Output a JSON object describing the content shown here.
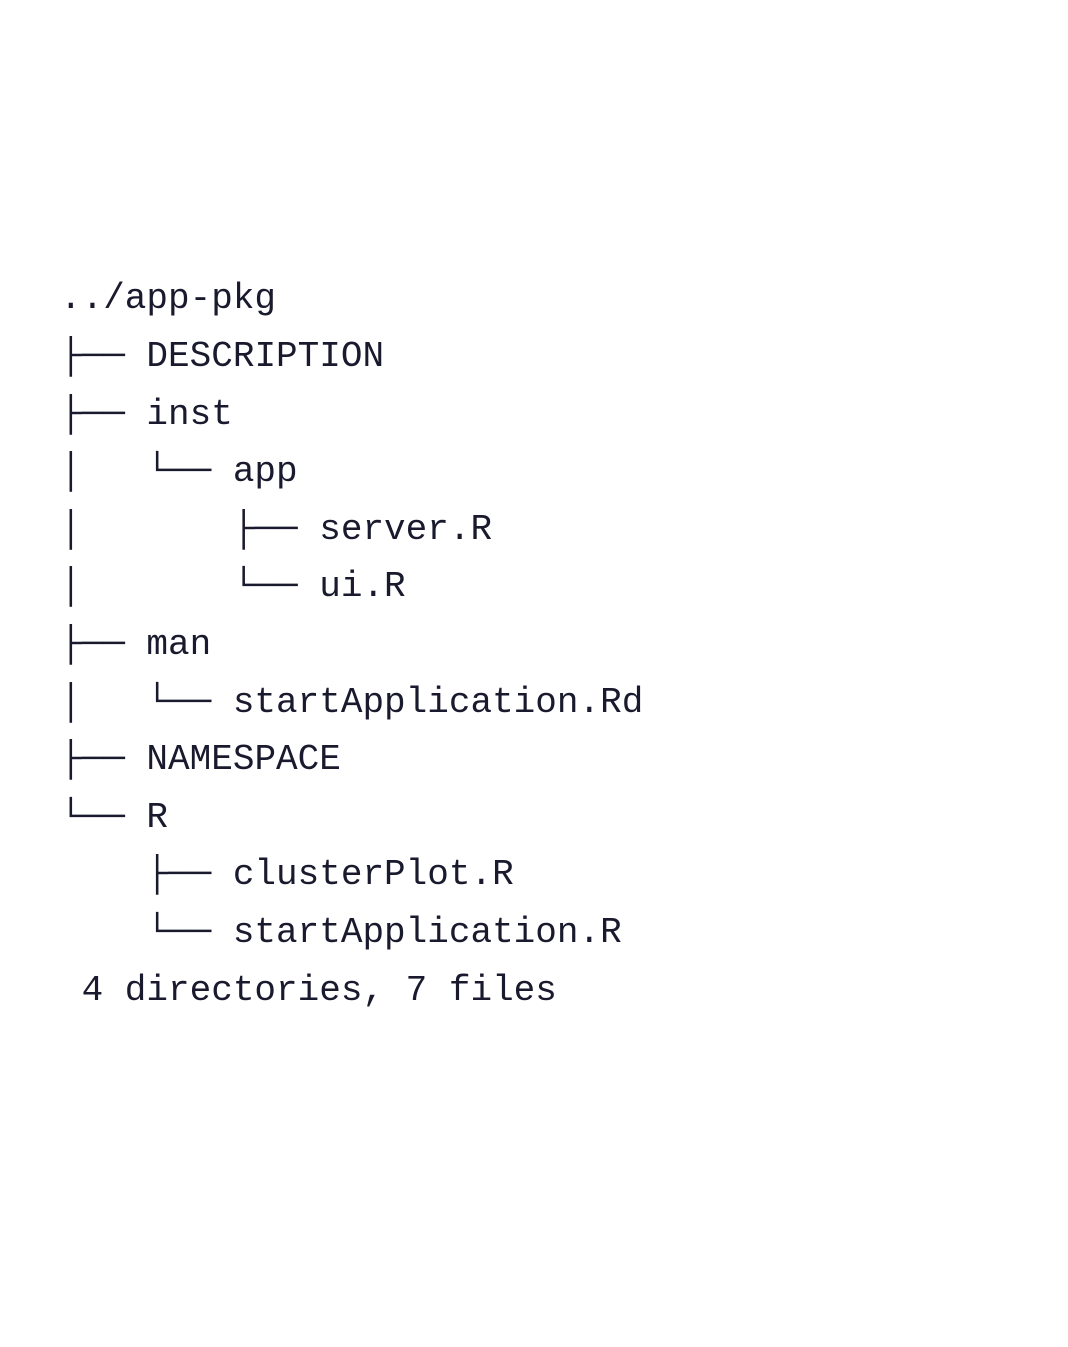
{
  "tree": {
    "root": "../app-pkg",
    "entries": [
      {
        "prefix": "├── ",
        "name": "DESCRIPTION"
      },
      {
        "prefix": "├── ",
        "name": "inst"
      },
      {
        "prefix": "│   └── ",
        "name": "app"
      },
      {
        "prefix": "│       ├── ",
        "name": "server.R"
      },
      {
        "prefix": "│       └── ",
        "name": "ui.R"
      },
      {
        "prefix": "├── ",
        "name": "man"
      },
      {
        "prefix": "│   └── ",
        "name": "startApplication.Rd"
      },
      {
        "prefix": "├── ",
        "name": "NAMESPACE"
      },
      {
        "prefix": "└── ",
        "name": "R"
      },
      {
        "prefix": "    ├── ",
        "name": "clusterPlot.R"
      },
      {
        "prefix": "    └── ",
        "name": "startApplication.R"
      }
    ]
  },
  "summary": " 4 directories, 7 files"
}
